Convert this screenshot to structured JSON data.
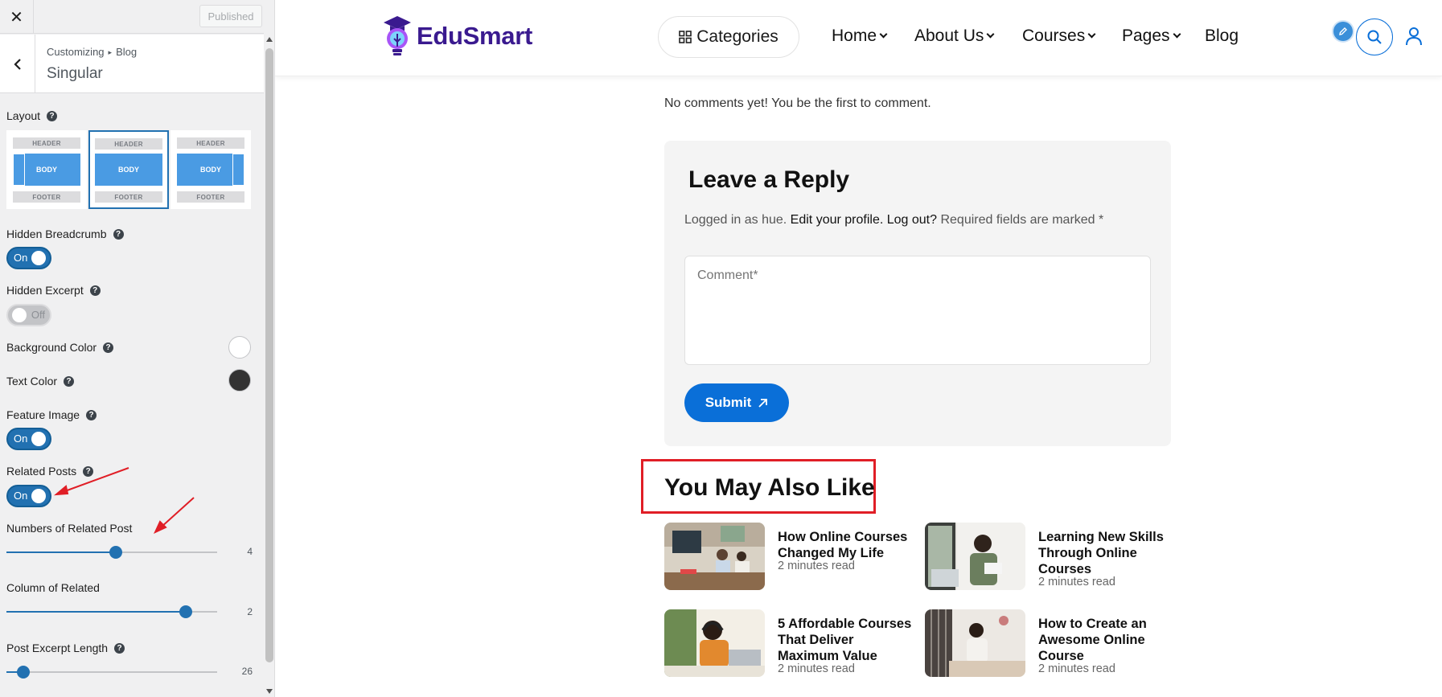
{
  "customizer": {
    "close_icon": "close-icon",
    "published_label": "Published",
    "breadcrumb": [
      "Customizing",
      "Blog"
    ],
    "section_title": "Singular",
    "controls": {
      "layout": {
        "label": "Layout",
        "options": [
          {
            "header": "HEADER",
            "body": "BODY",
            "footer": "FOOTER",
            "variant": "left-sidebar"
          },
          {
            "header": "HEADER",
            "body": "BODY",
            "footer": "FOOTER",
            "variant": "full-width"
          },
          {
            "header": "HEADER",
            "body": "BODY",
            "footer": "FOOTER",
            "variant": "right-sidebar"
          }
        ],
        "selected_index": 1
      },
      "hidden_breadcrumb": {
        "label": "Hidden Breadcrumb",
        "state": "On"
      },
      "hidden_excerpt": {
        "label": "Hidden Excerpt",
        "state": "Off"
      },
      "background_color": {
        "label": "Background Color",
        "value": "#ffffff"
      },
      "text_color": {
        "label": "Text Color",
        "value": "#333333"
      },
      "feature_image": {
        "label": "Feature Image",
        "state": "On"
      },
      "related_posts": {
        "label": "Related Posts",
        "state": "On"
      },
      "numbers_related": {
        "label": "Numbers of Related Post",
        "value": "4",
        "fill_fraction": 0.52
      },
      "column_related": {
        "label": "Column of Related",
        "value": "2",
        "fill_fraction": 0.85
      },
      "excerpt_length": {
        "label": "Post Excerpt Length",
        "value": "26",
        "fill_fraction": 0.08
      }
    }
  },
  "site": {
    "logo_text": "EduSmart",
    "categories_label": "Categories",
    "nav": [
      {
        "label": "Home",
        "dropdown": true
      },
      {
        "label": "About Us",
        "dropdown": true
      },
      {
        "label": "Courses",
        "dropdown": true
      },
      {
        "label": "Pages",
        "dropdown": true
      },
      {
        "label": "Blog",
        "dropdown": false
      }
    ],
    "comments": {
      "empty_text": "No comments yet! You be the first to comment.",
      "reply_title": "Leave a Reply",
      "logged_in_prefix": "Logged in as hue.",
      "edit_profile": "Edit your profile.",
      "log_out": "Log out?",
      "required_text": "Required fields are marked *",
      "comment_placeholder": "Comment*",
      "submit_label": "Submit"
    },
    "related": {
      "heading": "You May Also Like",
      "posts": [
        {
          "title": "How Online Courses Changed My Life",
          "read": "2 minutes read"
        },
        {
          "title": "Learning New Skills Through Online Courses",
          "read": "2 minutes read"
        },
        {
          "title": "5 Affordable Courses That Deliver Maximum Value",
          "read": "2 minutes read"
        },
        {
          "title": "How to Create an Awesome Online Course",
          "read": "2 minutes read"
        }
      ]
    }
  },
  "colors": {
    "accent": "#2271b1",
    "site_primary": "#0a6fd8",
    "logo": "#3a1a8f",
    "annotation_red": "#e01e26"
  }
}
